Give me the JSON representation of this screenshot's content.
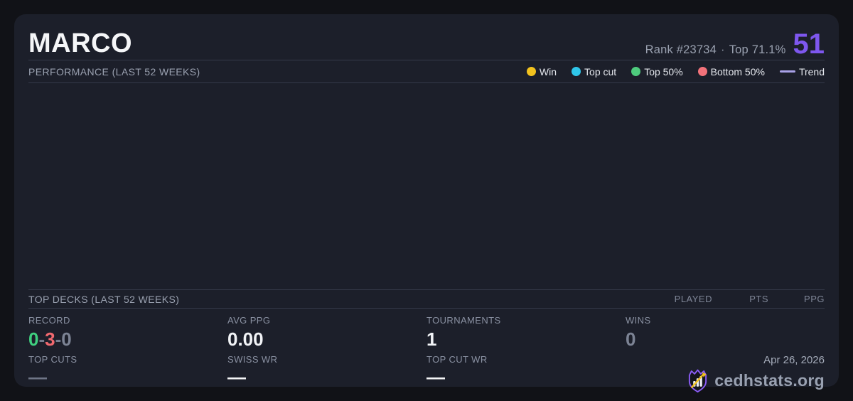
{
  "header": {
    "title": "MARCO",
    "rank_text": "Rank #23734",
    "separator": "·",
    "top_percent": "Top 71.1%",
    "score": "51"
  },
  "performance": {
    "section_title": "PERFORMANCE (LAST 52 WEEKS)",
    "legend": [
      {
        "label": "Win",
        "color": "#f2c21e"
      },
      {
        "label": "Top cut",
        "color": "#2fc6ea"
      },
      {
        "label": "Top 50%",
        "color": "#4ecb7d"
      },
      {
        "label": "Bottom 50%",
        "color": "#f2727a"
      },
      {
        "label": "Trend",
        "color": "#a9a2e8"
      }
    ]
  },
  "top_decks": {
    "section_title": "TOP DECKS (LAST 52 WEEKS)",
    "columns": [
      "PLAYED",
      "PTS",
      "PPG"
    ]
  },
  "stats": {
    "record": {
      "label": "RECORD",
      "wins": "0",
      "losses": "3",
      "draws": "0",
      "separator": "-"
    },
    "avg_ppg": {
      "label": "AVG PPG",
      "value": "0.00"
    },
    "tournaments": {
      "label": "TOURNAMENTS",
      "value": "1"
    },
    "wins": {
      "label": "WINS",
      "value": "0"
    },
    "top_cuts": {
      "label": "TOP CUTS",
      "value": "—"
    },
    "swiss_wr": {
      "label": "SWISS WR",
      "value": "—"
    },
    "top_cut_wr": {
      "label": "TOP CUT WR",
      "value": "—"
    }
  },
  "footer": {
    "date": "Apr 26, 2026",
    "brand": "cedhstats.org"
  },
  "colors": {
    "accent_purple": "#7e57ee",
    "win_green": "#3fcf7f",
    "loss_red": "#f0696f",
    "draw_gray": "#7c8394",
    "card_bg": "#1c1f2a",
    "page_bg": "#111217",
    "logo_purple": "#8b5cf6",
    "logo_yellow": "#f2c21e"
  }
}
